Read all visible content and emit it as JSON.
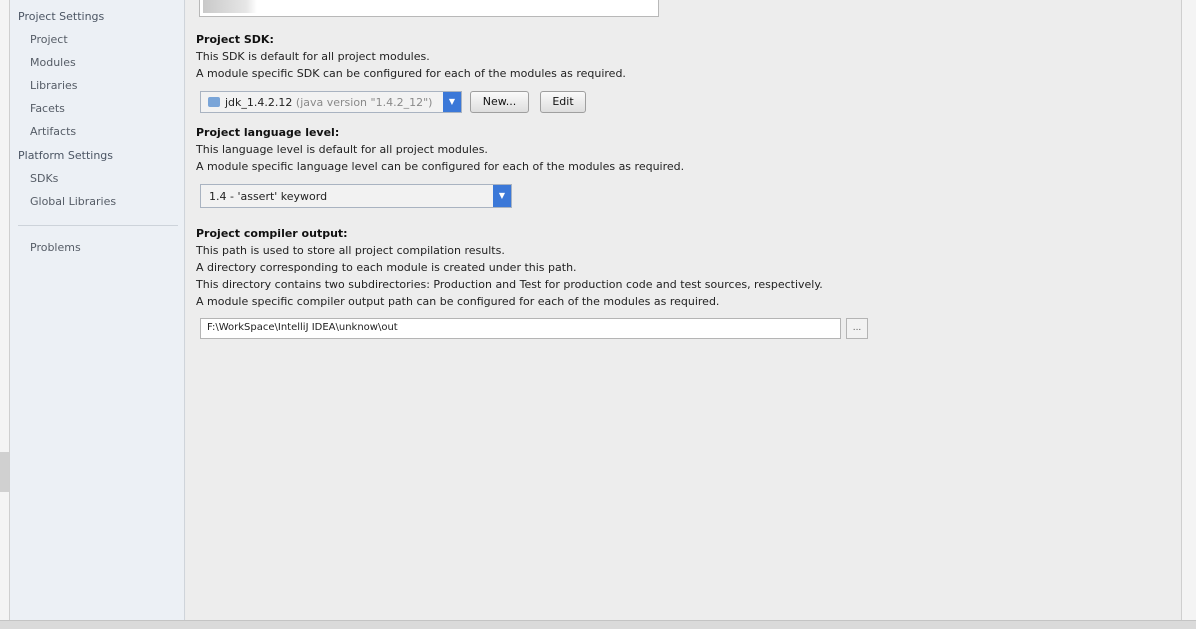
{
  "sidebar": {
    "project_settings_header": "Project Settings",
    "project_items": [
      "Project",
      "Modules",
      "Libraries",
      "Facets",
      "Artifacts"
    ],
    "platform_settings_header": "Platform Settings",
    "platform_items": [
      "SDKs",
      "Global Libraries"
    ],
    "problems": "Problems"
  },
  "sdk": {
    "title": "Project SDK:",
    "desc1": "This SDK is default for all project modules.",
    "desc2": "A module specific SDK can be configured for each of the modules as required.",
    "selected": "jdk_1.4.2.12",
    "selected_hint": "(java version \"1.4.2_12\")",
    "new_button": "New...",
    "edit_button": "Edit"
  },
  "language": {
    "title": "Project language level:",
    "desc1": "This language level is default for all project modules.",
    "desc2": "A module specific language level can be configured for each of the modules as required.",
    "selected": "1.4 - 'assert' keyword"
  },
  "compiler": {
    "title": "Project compiler output:",
    "desc1": "This path is used to store all project compilation results.",
    "desc2": "A directory corresponding to each module is created under this path.",
    "desc3": "This directory contains two subdirectories: Production and Test for production code and test sources, respectively.",
    "desc4": "A module specific compiler output path can be configured for each of the modules as required.",
    "path": "F:\\WorkSpace\\IntelliJ IDEA\\unknow\\out",
    "browse_button": "..."
  },
  "colors": {
    "accent": "#3b78d8",
    "sidebar_bg": "#ecf0f5",
    "content_bg": "#ededed"
  },
  "icons": {
    "dropdown": "chevron-down-icon",
    "sdk": "folder-icon"
  }
}
